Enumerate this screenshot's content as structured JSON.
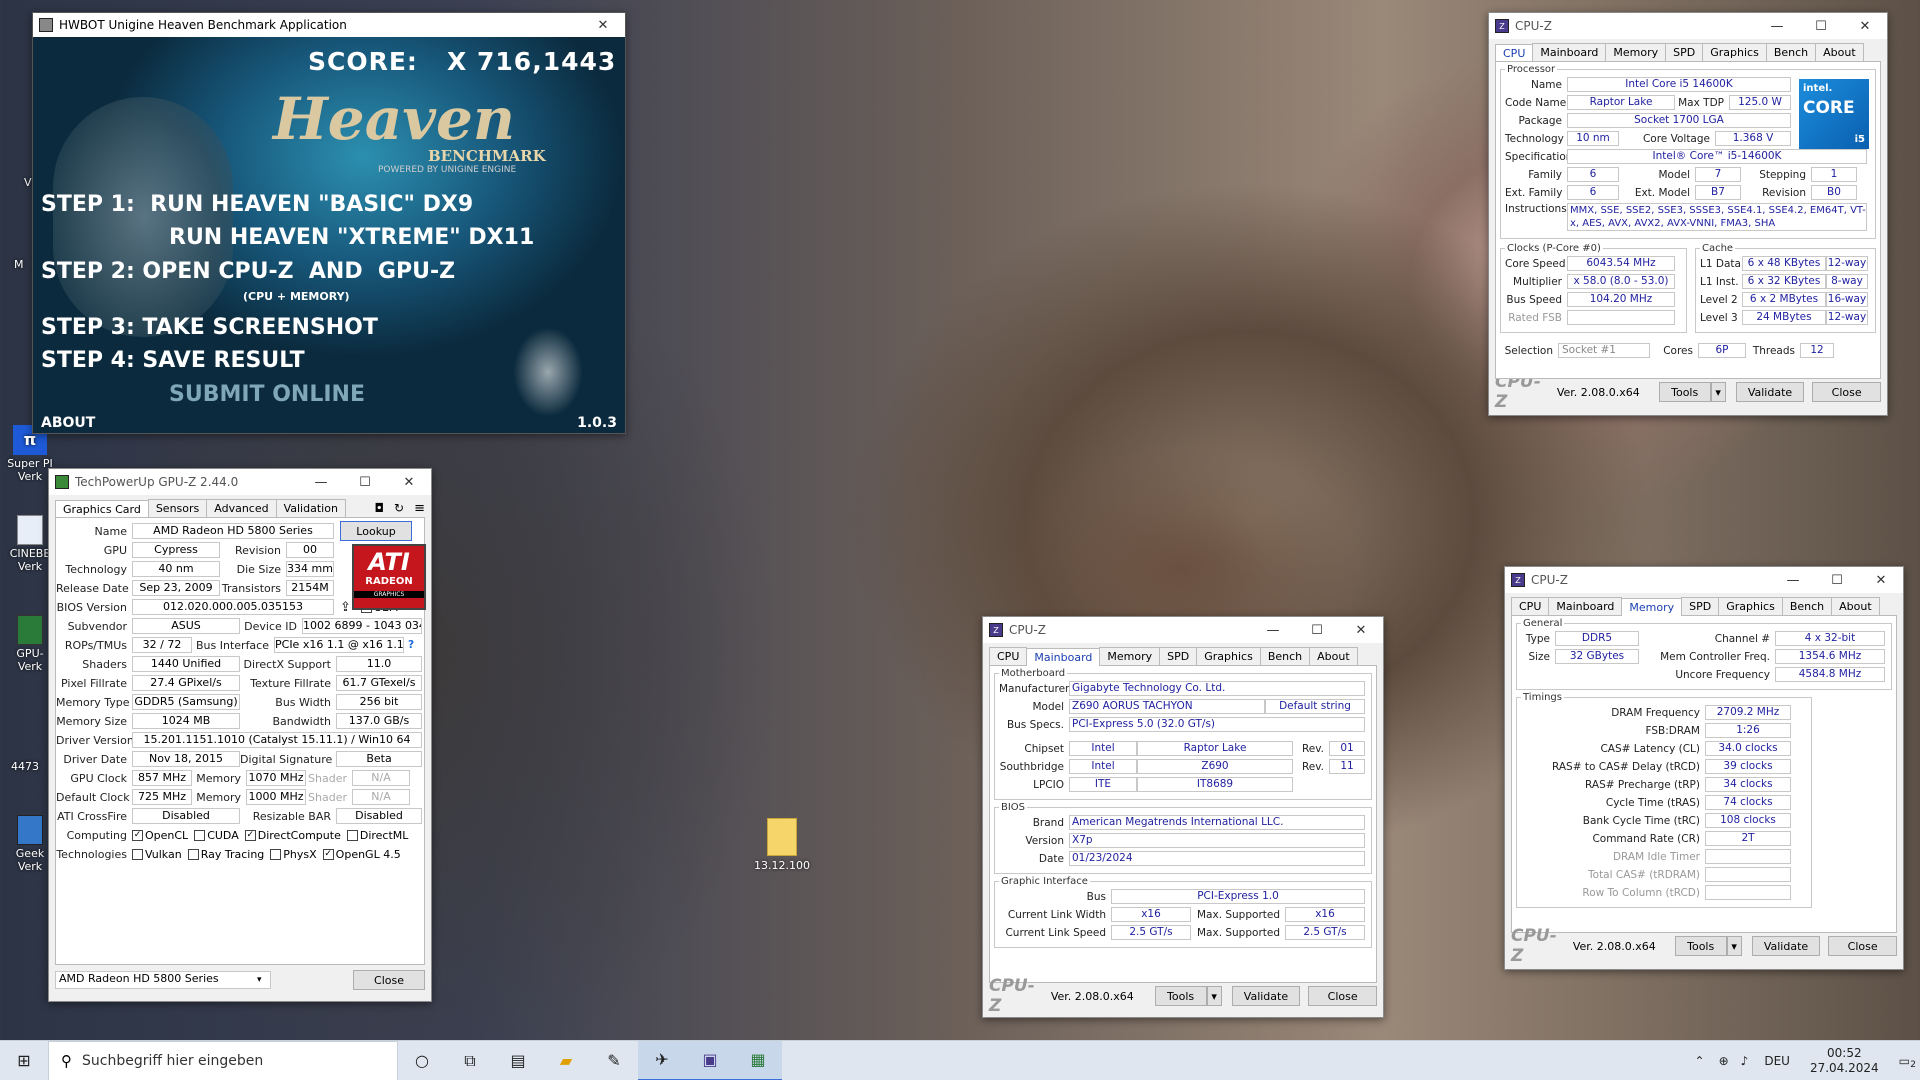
{
  "desktop": {
    "icons": [
      {
        "label": "Super PI\nVerk"
      },
      {
        "label": "CINEBE\nVerk"
      },
      {
        "label": "GPU-\nVerk"
      },
      {
        "label": "4473"
      },
      {
        "label": "Geek\nVerk"
      },
      {
        "label": "M"
      },
      {
        "label": "V"
      }
    ],
    "file_label": "13.12.100"
  },
  "heaven": {
    "title": "HWBOT Unigine Heaven Benchmark Application",
    "score": "SCORE:   X 716,1443",
    "logo": "Heaven",
    "logo_sub": "BENCHMARK",
    "powered": "POWERED BY UNIGINE ENGINE",
    "step1": "STEP 1:  RUN HEAVEN \"BASIC\" DX9",
    "step1b": "RUN HEAVEN \"XTREME\" DX11",
    "step2": "STEP 2: OPEN CPU-Z  AND  GPU-Z",
    "step2b": "(CPU + MEMORY)",
    "step3": "STEP 3: TAKE SCREENSHOT",
    "step4": "STEP 4: SAVE RESULT",
    "step4b": "SUBMIT ONLINE",
    "about": "ABOUT",
    "version": "1.0.3"
  },
  "cpuz_cpu": {
    "title": "CPU-Z",
    "tabs": [
      "CPU",
      "Mainboard",
      "Memory",
      "SPD",
      "Graphics",
      "Bench",
      "About"
    ],
    "processor": "Processor",
    "name_l": "Name",
    "name": "Intel Core i5 14600K",
    "code_l": "Code Name",
    "code": "Raptor Lake",
    "tdp_l": "Max TDP",
    "tdp": "125.0 W",
    "pkg_l": "Package",
    "pkg": "Socket 1700 LGA",
    "tech_l": "Technology",
    "tech": "10 nm",
    "volt_l": "Core Voltage",
    "volt": "1.368 V",
    "spec_l": "Specification",
    "spec": "Intel® Core™ i5-14600K",
    "fam_l": "Family",
    "fam": "6",
    "model_l": "Model",
    "model": "7",
    "step_l": "Stepping",
    "step": "1",
    "efam_l": "Ext. Family",
    "efam": "6",
    "emodel_l": "Ext. Model",
    "emodel": "B7",
    "rev_l": "Revision",
    "rev": "B0",
    "inst_l": "Instructions",
    "inst": "MMX, SSE, SSE2, SSE3, SSSE3, SSE4.1, SSE4.2, EM64T, VT-x, AES, AVX, AVX2, AVX-VNNI, FMA3, SHA",
    "clocks": "Clocks (P-Core #0)",
    "cs_l": "Core Speed",
    "cs": "6043.54 MHz",
    "mul_l": "Multiplier",
    "mul": "x 58.0 (8.0 - 53.0)",
    "bus_l": "Bus Speed",
    "bus": "104.20 MHz",
    "fsb_l": "Rated FSB",
    "fsb": "",
    "cache": "Cache",
    "l1d_l": "L1 Data",
    "l1d": "6 x 48 KBytes",
    "l1d_w": "12-way",
    "l1i_l": "L1 Inst.",
    "l1i": "6 x 32 KBytes",
    "l1i_w": "8-way",
    "l2_l": "Level 2",
    "l2": "6 x 2 MBytes",
    "l2_w": "16-way",
    "l3_l": "Level 3",
    "l3": "24 MBytes",
    "l3_w": "12-way",
    "sel_l": "Selection",
    "sel": "Socket #1",
    "cores_l": "Cores",
    "cores": "6P",
    "thr_l": "Threads",
    "thr": "12",
    "logo_intel": "intel.",
    "logo_core": "CORE",
    "logo_i": "i5",
    "brand": "CPU-Z",
    "ver": "Ver. 2.08.0.x64",
    "tools": "Tools",
    "validate": "Validate",
    "close": "Close"
  },
  "gpuz": {
    "title": "TechPowerUp GPU-Z 2.44.0",
    "tabs": [
      "Graphics Card",
      "Sensors",
      "Advanced",
      "Validation"
    ],
    "name_l": "Name",
    "name": "AMD Radeon HD 5800 Series",
    "lookup": "Lookup",
    "gpu_l": "GPU",
    "gpu": "Cypress",
    "rev_l": "Revision",
    "rev": "00",
    "tech_l": "Technology",
    "tech": "40 nm",
    "die_l": "Die Size",
    "die": "334 mm²",
    "rel_l": "Release Date",
    "rel": "Sep 23, 2009",
    "tr_l": "Transistors",
    "tr": "2154M",
    "bios_l": "BIOS Version",
    "bios": "012.020.000.005.035153",
    "uefi": "UEFI",
    "sub_l": "Subvendor",
    "sub": "ASUS",
    "dev_l": "Device ID",
    "dev": "1002 6899 - 1043 0348",
    "rop_l": "ROPs/TMUs",
    "rop": "32 / 72",
    "bi_l": "Bus Interface",
    "bi": "PCIe x16 1.1 @ x16 1.1",
    "sh_l": "Shaders",
    "sh": "1440 Unified",
    "dx_l": "DirectX Support",
    "dx": "11.0",
    "pf_l": "Pixel Fillrate",
    "pf": "27.4 GPixel/s",
    "tf_l": "Texture Fillrate",
    "tf": "61.7 GTexel/s",
    "mt_l": "Memory Type",
    "mt": "GDDR5 (Samsung)",
    "bw_l": "Bus Width",
    "bw": "256 bit",
    "ms_l": "Memory Size",
    "ms": "1024 MB",
    "band_l": "Bandwidth",
    "band": "137.0 GB/s",
    "drv_l": "Driver Version",
    "drv": "15.201.1151.1010 (Catalyst 15.11.1) / Win10 64",
    "dd_l": "Driver Date",
    "dd": "Nov 18, 2015",
    "ds_l": "Digital Signature",
    "ds": "Beta",
    "gc_l": "GPU Clock",
    "gc": "857 MHz",
    "mem_l": "Memory",
    "gcm": "1070 MHz",
    "shd_l": "Shader",
    "na": "N/A",
    "dc_l": "Default Clock",
    "dc": "725 MHz",
    "dcm": "1000 MHz",
    "cf_l": "ATI CrossFire",
    "cf": "Disabled",
    "rb_l": "Resizable BAR",
    "rb": "Disabled",
    "comp_l": "Computing",
    "tech2_l": "Technologies",
    "opencl": "OpenCL",
    "cuda": "CUDA",
    "dc2": "DirectCompute",
    "dml": "DirectML",
    "vulkan": "Vulkan",
    "rt": "Ray Tracing",
    "physx": "PhysX",
    "ogl": "OpenGL 4.5",
    "select": "AMD Radeon HD 5800 Series",
    "close": "Close",
    "ati": "ATI",
    "radeon": "RADEON",
    "graphics": "GRAPHICS"
  },
  "cpuz_mb": {
    "title": "CPU-Z",
    "tabs": [
      "CPU",
      "Mainboard",
      "Memory",
      "SPD",
      "Graphics",
      "Bench",
      "About"
    ],
    "mb": "Motherboard",
    "man_l": "Manufacturer",
    "man": "Gigabyte Technology Co. Ltd.",
    "model_l": "Model",
    "model": "Z690 AORUS TACHYON",
    "model2": "Default string",
    "bs_l": "Bus Specs.",
    "bs": "PCI-Express 5.0 (32.0 GT/s)",
    "chip_l": "Chipset",
    "chip": "Intel",
    "chip2": "Raptor Lake",
    "rev_l": "Rev.",
    "chip_rev": "01",
    "sb_l": "Southbridge",
    "sb": "Intel",
    "sb2": "Z690",
    "sb_rev": "11",
    "lpc_l": "LPCIO",
    "lpc": "ITE",
    "lpc2": "IT8689",
    "bios": "BIOS",
    "brand_l": "Brand",
    "brand": "American Megatrends International LLC.",
    "ver_l": "Version",
    "ver": "X7p",
    "date_l": "Date",
    "date": "01/23/2024",
    "gi": "Graphic Interface",
    "bus_l": "Bus",
    "bus": "PCI-Express 1.0",
    "clw_l": "Current Link Width",
    "clw": "x16",
    "ms_l": "Max. Supported",
    "msw": "x16",
    "cls_l": "Current Link Speed",
    "cls": "2.5 GT/s",
    "mss": "2.5 GT/s",
    "brandz": "CPU-Z",
    "verz": "Ver. 2.08.0.x64",
    "tools": "Tools",
    "validate": "Validate",
    "close": "Close"
  },
  "cpuz_mem": {
    "title": "CPU-Z",
    "tabs": [
      "CPU",
      "Mainboard",
      "Memory",
      "SPD",
      "Graphics",
      "Bench",
      "About"
    ],
    "gen": "General",
    "type_l": "Type",
    "type": "DDR5",
    "ch_l": "Channel #",
    "ch": "4 x 32-bit",
    "size_l": "Size",
    "size": "32 GBytes",
    "mcf_l": "Mem Controller Freq.",
    "mcf": "1354.6 MHz",
    "unc_l": "Uncore Frequency",
    "unc": "4584.8 MHz",
    "tim": "Timings",
    "rows": [
      {
        "l": "DRAM Frequency",
        "v": "2709.2 MHz",
        "dim": false
      },
      {
        "l": "FSB:DRAM",
        "v": "1:26",
        "dim": false
      },
      {
        "l": "CAS# Latency (CL)",
        "v": "34.0 clocks",
        "dim": false
      },
      {
        "l": "RAS# to CAS# Delay (tRCD)",
        "v": "39 clocks",
        "dim": false
      },
      {
        "l": "RAS# Precharge (tRP)",
        "v": "34 clocks",
        "dim": false
      },
      {
        "l": "Cycle Time (tRAS)",
        "v": "74 clocks",
        "dim": false
      },
      {
        "l": "Bank Cycle Time (tRC)",
        "v": "108 clocks",
        "dim": false
      },
      {
        "l": "Command Rate (CR)",
        "v": "2T",
        "dim": false
      },
      {
        "l": "DRAM Idle Timer",
        "v": "",
        "dim": true
      },
      {
        "l": "Total CAS# (tRDRAM)",
        "v": "",
        "dim": true
      },
      {
        "l": "Row To Column (tRCD)",
        "v": "",
        "dim": true
      }
    ],
    "brandz": "CPU-Z",
    "verz": "Ver. 2.08.0.x64",
    "tools": "Tools",
    "validate": "Validate",
    "close": "Close"
  },
  "taskbar": {
    "search": "Suchbegriff hier eingeben",
    "lang": "DEU",
    "time": "00:52",
    "date": "27.04.2024",
    "notif": "2"
  },
  "colors": {
    "accent": "#1f1fa0",
    "heaven_bg": "#1a6a8a",
    "task": "#dfe6ef"
  }
}
